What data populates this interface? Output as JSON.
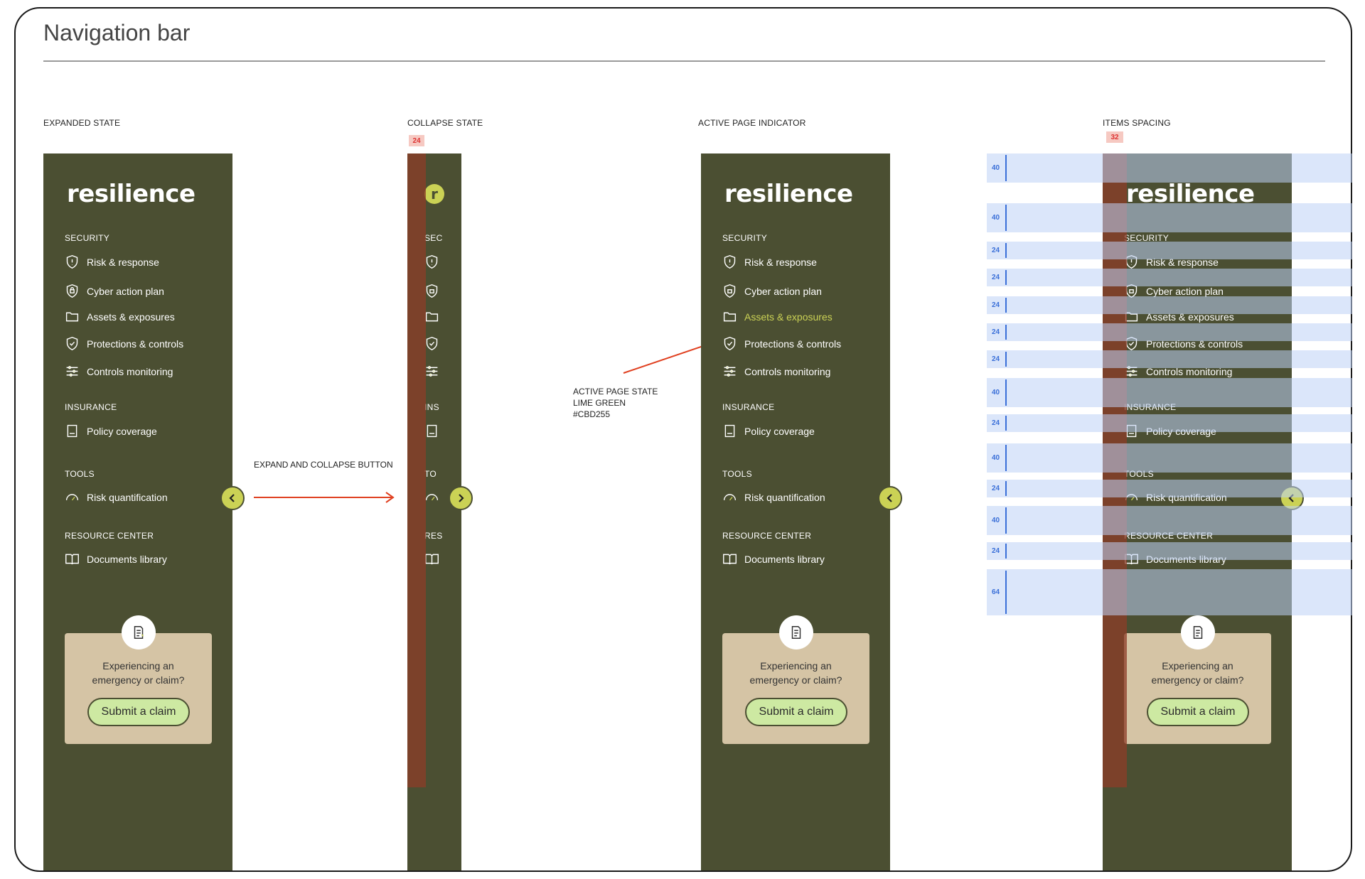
{
  "page": {
    "title": "Navigation bar"
  },
  "sections": {
    "expanded": "EXPANDED STATE",
    "collapsed": "COLLAPSE STATE",
    "active": "ACTIVE PAGE INDICATOR",
    "spacing": "ITEMS SPACING"
  },
  "nav": {
    "logo": "resilience",
    "logo_mark": "r",
    "groups": {
      "security": "SECURITY",
      "insurance": "INSURANCE",
      "tools": "TOOLS",
      "resource": "RESOURCE CENTER"
    },
    "groups_short": {
      "security": "SEC",
      "insurance": "INS",
      "tools": "TO",
      "resource": "RES"
    },
    "items": {
      "risk": "Risk & response",
      "cyber": "Cyber action plan",
      "assets": "Assets & exposures",
      "protections": "Protections & controls",
      "controls": "Controls monitoring",
      "policy": "Policy coverage",
      "quant": "Risk quantification",
      "docs": "Documents library"
    },
    "icons": [
      "shield-alert-icon",
      "shield-lock-icon",
      "folder-icon",
      "shield-check-icon",
      "sliders-icon",
      "book-icon",
      "gauge-icon",
      "open-book-icon"
    ],
    "claim": {
      "text": "Experiencing an emergency or claim?",
      "button": "Submit a claim"
    },
    "colors": {
      "background": "#4b4f32",
      "accent": "#cbd255",
      "card": "#d5c4a5"
    }
  },
  "annotations": {
    "expand_collapse": "EXPAND AND COLLAPSE BUTTON",
    "active_line1": "ACTIVE PAGE  STATE",
    "active_line2": "LIME GREEN",
    "active_line3": "#CBD255",
    "collapse_width": "24",
    "spacing_width": "32"
  },
  "spacing_values": [
    "40",
    "40",
    "24",
    "24",
    "24",
    "24",
    "24",
    "40",
    "24",
    "40",
    "24",
    "40",
    "24",
    "64"
  ]
}
